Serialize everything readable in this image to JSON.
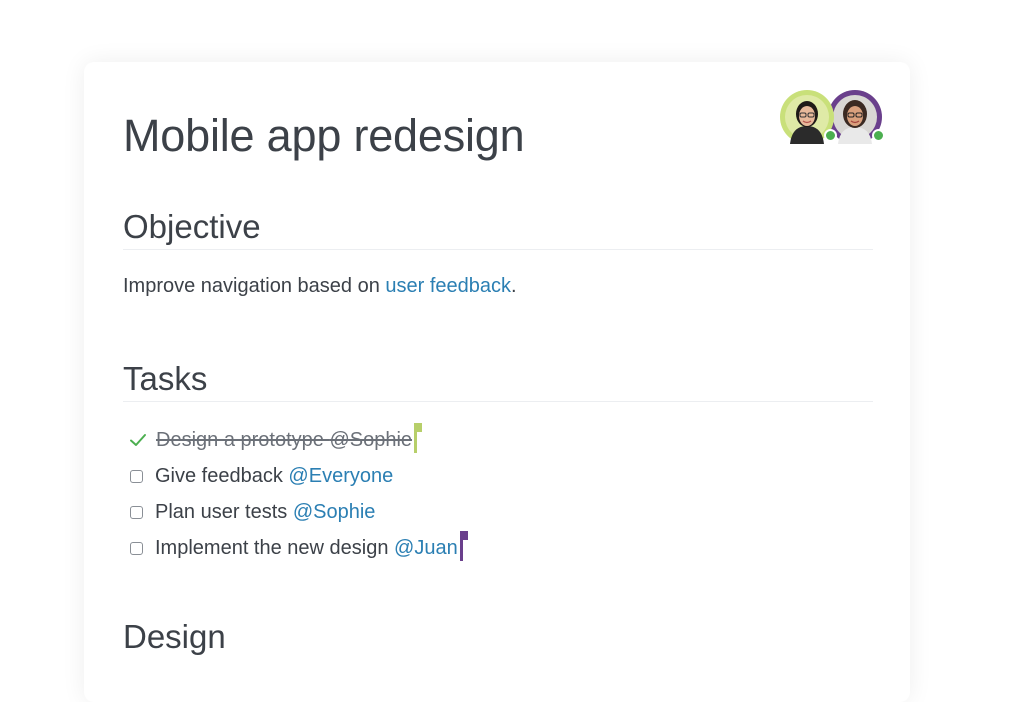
{
  "document": {
    "title": "Mobile app redesign"
  },
  "collaborators": [
    {
      "name": "Sophie",
      "ring_color": "#c9e07a",
      "online": true
    },
    {
      "name": "Juan",
      "ring_color": "#6a3f8c",
      "online": true
    }
  ],
  "sections": {
    "objective": {
      "heading": "Objective",
      "text_before": "Improve navigation based on ",
      "link_text": "user feedback",
      "text_after": "."
    },
    "tasks": {
      "heading": "Tasks",
      "items": [
        {
          "text": "Design a prototype ",
          "mention": "@Sophie",
          "done": true
        },
        {
          "text": "Give feedback ",
          "mention": "@Everyone",
          "done": false
        },
        {
          "text": "Plan user tests ",
          "mention": "@Sophie",
          "done": false
        },
        {
          "text": "Implement the new design ",
          "mention": "@Juan",
          "done": false
        }
      ]
    },
    "design": {
      "heading": "Design"
    }
  },
  "colors": {
    "text": "#3c4148",
    "link": "#2b7fb3",
    "check": "#4caf50",
    "cursor_sophie": "#b7cf6a",
    "cursor_juan": "#6a3f8c"
  },
  "icons": {
    "done": "check-icon",
    "todo": "checkbox-icon"
  }
}
